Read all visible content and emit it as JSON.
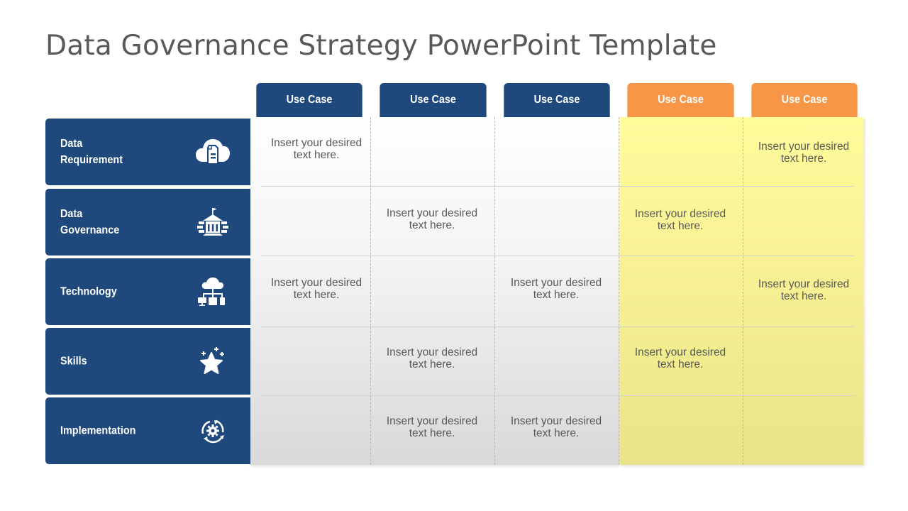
{
  "title": "Data Governance Strategy PowerPoint Template",
  "colors": {
    "navy": "#1f497d",
    "orange": "#f79646",
    "yellow": "#fffc9c",
    "gray_text": "#595959"
  },
  "columns": [
    {
      "label": "Use Case",
      "color": "navy"
    },
    {
      "label": "Use Case",
      "color": "navy"
    },
    {
      "label": "Use Case",
      "color": "navy"
    },
    {
      "label": "Use Case",
      "color": "orange"
    },
    {
      "label": "Use Case",
      "color": "orange"
    }
  ],
  "rows": [
    {
      "label_line1": "Data",
      "label_line2": "Requirement",
      "icon": "cloud-document-icon",
      "cells": [
        "Insert your desired text here.",
        "",
        "",
        "",
        "Insert your desired text here."
      ]
    },
    {
      "label_line1": "Data",
      "label_line2": "Governance",
      "icon": "government-building-icon",
      "cells": [
        "",
        "Insert your desired text here.",
        "",
        "Insert your desired text here.",
        ""
      ]
    },
    {
      "label_line1": "Technology",
      "label_line2": "",
      "icon": "cloud-network-icon",
      "cells": [
        "Insert your desired text here.",
        "",
        "Insert your desired text here.",
        "",
        "Insert your desired text here."
      ]
    },
    {
      "label_line1": "Skills",
      "label_line2": "",
      "icon": "star-sparkle-icon",
      "cells": [
        "",
        "Insert your desired text here.",
        "",
        "Insert your desired text here.",
        ""
      ]
    },
    {
      "label_line1": "Implementation",
      "label_line2": "",
      "icon": "cycle-gear-icon",
      "cells": [
        "",
        "Insert your desired text here.",
        "Insert your desired text here.",
        "",
        ""
      ]
    }
  ]
}
